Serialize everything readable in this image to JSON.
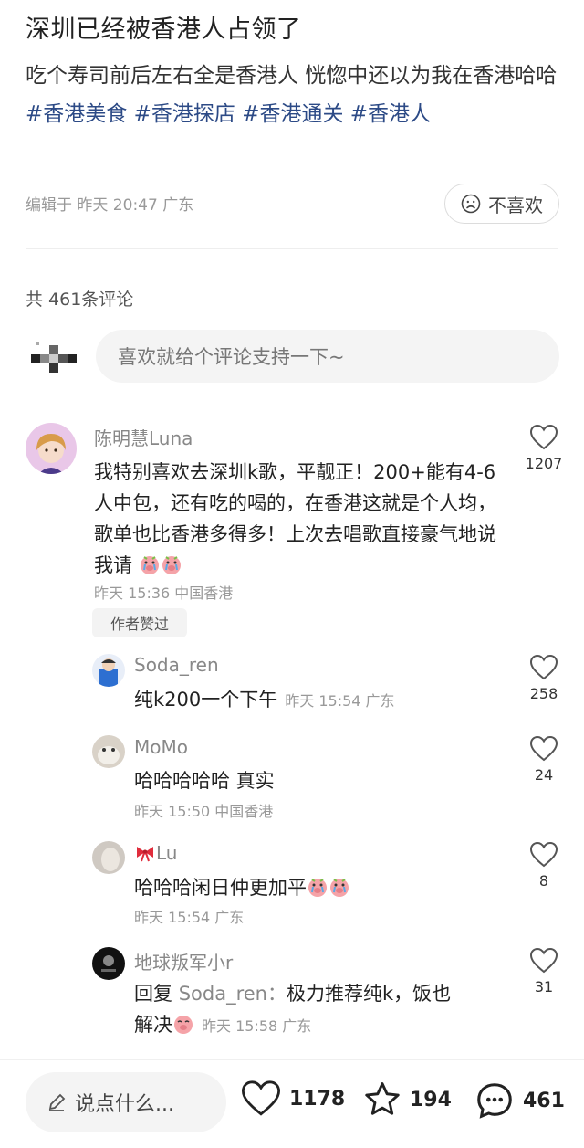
{
  "post": {
    "title": "深圳已经被香港人占领了",
    "body_text": "吃个寿司前后左右全是香港人 恍惚中还以为我在香港哈哈",
    "tags": [
      "#香港美食",
      "#香港探店",
      "#香港通关",
      "#香港人"
    ],
    "edited_meta": "编辑于 昨天 20:47 广东",
    "dislike_label": "不喜欢"
  },
  "comments_header": {
    "count_text": "共 461条评论",
    "input_placeholder": "喜欢就给个评论支持一下~"
  },
  "comments": [
    {
      "username": "陈明慧Luna",
      "text": "我特别喜欢去深圳k歌，平靓正！200+能有4-6人中包，还有吃的喝的，在香港这就是个人均，歌单也比香港多得多！上次去唱歌直接豪气地说我请",
      "meta": "昨天 15:36 中国香港",
      "likes": "1207",
      "badge": "作者赞过",
      "emoji": [
        "crying-pig",
        "crying-pig"
      ]
    },
    {
      "username": "Soda_ren",
      "text": "纯k200一个下午",
      "meta": "昨天 15:54 广东",
      "likes": "258"
    },
    {
      "username": "MoMo",
      "text": "哈哈哈哈哈 真实",
      "meta": "昨天 15:50 中国香港",
      "likes": "24"
    },
    {
      "username": "Lu",
      "username_prefix_icon": "red-bow",
      "text": "哈哈哈闲日仲更加平",
      "meta": "昨天 15:54 广东",
      "likes": "8",
      "emoji": [
        "crying-pig",
        "crying-pig"
      ]
    },
    {
      "username": "地球叛军小r",
      "reply_prefix": "回复",
      "reply_to": "Soda_ren：",
      "text_line1": "极力推荐纯k，饭也",
      "text_line2": "解决",
      "meta": "昨天 15:58 广东",
      "likes": "31",
      "emoji": [
        "smiling-pig"
      ]
    }
  ],
  "bottom_bar": {
    "input_placeholder": "说点什么...",
    "likes": "1178",
    "favorites": "194",
    "comments": "461"
  },
  "colors": {
    "tag": "#2c4a86",
    "muted": "#999999",
    "pig_pink": "#f5a3a8"
  }
}
